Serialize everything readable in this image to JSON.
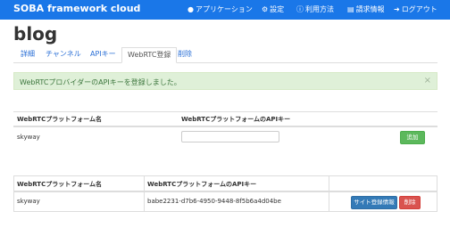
{
  "navbar": {
    "brand": "SOBA framework cloud",
    "items": [
      {
        "icon": "application-icon",
        "label": "アプリケーション"
      },
      {
        "icon": "gear-icon",
        "label": "設定"
      },
      {
        "icon": "info-icon",
        "label": "利用方法"
      },
      {
        "icon": "bill-icon",
        "label": "請求情報"
      },
      {
        "icon": "logout-icon",
        "label": "ログアウト"
      }
    ]
  },
  "page_title": "blog",
  "tabs": [
    {
      "label": "詳細",
      "active": false
    },
    {
      "label": "チャンネル",
      "active": false
    },
    {
      "label": "APIキー",
      "active": false
    },
    {
      "label": "WebRTC登録",
      "active": true
    },
    {
      "label": "削除",
      "active": false
    }
  ],
  "alert": {
    "message": "WebRTCプロバイダーのAPIキーを登録しました。",
    "close": "×"
  },
  "form_table": {
    "headers": [
      "WebRTCプラットフォーム名",
      "WebRTCプラットフォームのAPIキー"
    ],
    "row": {
      "platform": "skyway",
      "api_key_value": "",
      "add_label": "追加"
    }
  },
  "list_table": {
    "headers": [
      "WebRTCプラットフォーム名",
      "WebRTCプラットフォームのAPIキー"
    ],
    "rows": [
      {
        "platform": "skyway",
        "api_key": "babe2231-d7b6-4950-9448-8f5b6a4d04be",
        "site_btn": "サイト登録情報",
        "delete_btn": "削除"
      }
    ]
  },
  "colors": {
    "navbar": "#1a77e8",
    "alert_bg": "#dff0d8",
    "add_button": "#5cb85c",
    "site_button": "#337ab7",
    "delete_button": "#d9534f"
  }
}
